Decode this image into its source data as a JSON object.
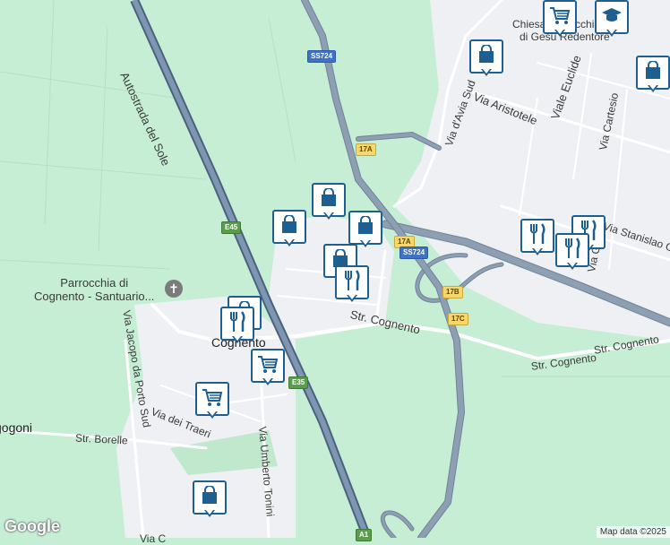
{
  "map": {
    "provider_logo": "Google",
    "attribution": "Map data ©2025",
    "labels": {
      "autostrada": "Autostrada del Sole",
      "parrocchia": "Parrocchia di\nCognento - Santuario...",
      "cognento": "Cognento",
      "via_jacopo": "Via Jacopo da Porto Sud",
      "via_traeri": "Via dei Traeri",
      "str_borelle": "Str. Borelle",
      "via_umberto": "Via Umberto Tonini",
      "str_cognento_center": "Str. Cognento",
      "str_cognento_right1": "Str. Cognento",
      "str_cognento_right2": "Str. Cognento",
      "via_aristotele": "Via Aristotele",
      "via_avia": "Via d'Avia Sud",
      "viale_euclide": "Viale Euclide",
      "via_cartesio": "Via Cartesio",
      "via_galilei": "Via Galilei",
      "via_stanislao": "Via Stanislao C",
      "chiesa_top": "Chiesa Parrocchia",
      "chiesa_bottom": "di Gesù Redentore",
      "ragoni": "gogoni",
      "via_bottom": "Via C"
    },
    "shields": {
      "ss724_top": "SS724",
      "a17_top": "17A",
      "a17_mid": "17A",
      "ss724_mid": "SS724",
      "b17": "17B",
      "c17": "17C",
      "e45": "E45",
      "e35": "E35",
      "a1": "A1"
    },
    "colors": {
      "green_area": "#c6eed5",
      "urban": "#eef0f3",
      "highway": "#8e9fb3",
      "highway_casing": "#6f8399",
      "local_road": "#ffffff",
      "pin_border": "#1e5f92"
    },
    "pins": [
      {
        "icon": "shopping-cart-icon",
        "title": "Supermarket"
      },
      {
        "icon": "graduation-cap-icon",
        "title": "School"
      },
      {
        "icon": "shopping-bag-icon",
        "title": "Shop"
      },
      {
        "icon": "shopping-bag-icon",
        "title": "Shop"
      },
      {
        "icon": "shopping-bag-icon",
        "title": "Shop"
      },
      {
        "icon": "shopping-bag-icon",
        "title": "Shop"
      },
      {
        "icon": "shopping-bag-icon",
        "title": "Shop"
      },
      {
        "icon": "shopping-bag-icon",
        "title": "Shop"
      },
      {
        "icon": "restaurant-icon",
        "title": "Restaurant"
      },
      {
        "icon": "restaurant-icon",
        "title": "Restaurant"
      },
      {
        "icon": "restaurant-icon",
        "title": "Restaurant"
      },
      {
        "icon": "restaurant-icon",
        "title": "Restaurant"
      },
      {
        "icon": "shopping-bag-icon",
        "title": "Shop"
      },
      {
        "icon": "restaurant-icon",
        "title": "Restaurant"
      },
      {
        "icon": "shopping-cart-icon",
        "title": "Supermarket"
      },
      {
        "icon": "shopping-cart-icon",
        "title": "Supermarket"
      },
      {
        "icon": "shopping-bag-icon",
        "title": "Shop"
      }
    ]
  }
}
